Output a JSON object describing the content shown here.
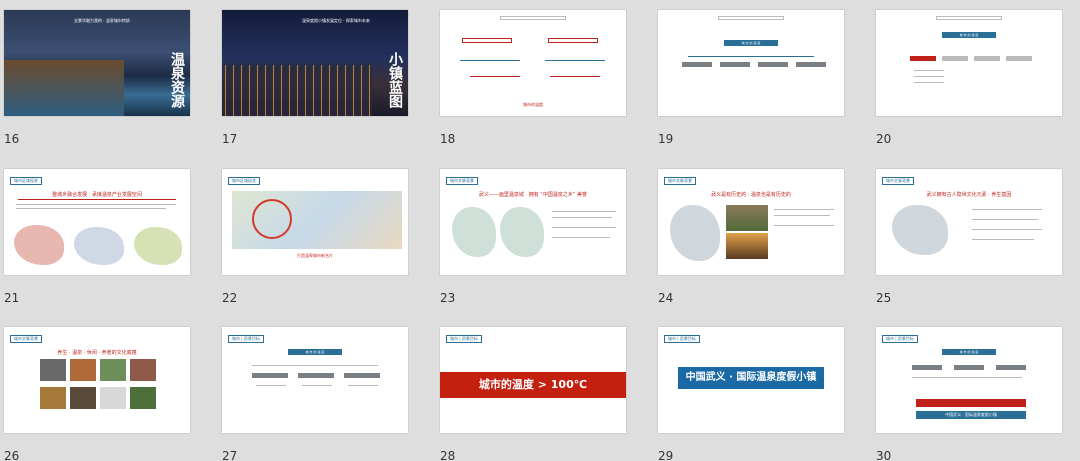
{
  "row1": [
    {
      "num": "16",
      "vtitle": "温泉资源",
      "caption": "全景华融为我的 · 温泉城市特质"
    },
    {
      "num": "17",
      "vtitle": "小镇蓝图",
      "caption": "温泉度假小镇发展定位 · 探索城市未来"
    },
    {
      "num": "18",
      "title": "城市的温度"
    },
    {
      "num": "19",
      "title": "城 市 的 温 度"
    },
    {
      "num": "20",
      "title": "城 市 的 温 度"
    }
  ],
  "row2": [
    {
      "num": "21",
      "header": "城市区域现状",
      "red": "整城乡融合发展 · 承接温泉产业发展空间"
    },
    {
      "num": "22",
      "header": "城市区域现状",
      "red": "打造温泉城市新名片"
    },
    {
      "num": "23",
      "header": "城市文脉背景",
      "red": "武义——画里温泉城 · 拥有 “中国温泉之乡” 美誉"
    },
    {
      "num": "24",
      "header": "城市文脉背景",
      "red": "武义是有历史的 · 温泉也是有历史的"
    },
    {
      "num": "25",
      "header": "城市文脉背景",
      "red": "武义拥有古人隐世文化元素 · 养生基因"
    }
  ],
  "row3": [
    {
      "num": "26",
      "header": "城市文脉背景",
      "red": "养生 · 温泉  · 休闲 · 养老的文化底蕴"
    },
    {
      "num": "27",
      "header": "城市 | 愿景目标",
      "title": "城 市 的 温 度"
    },
    {
      "num": "28",
      "header": "城市 | 愿景目标",
      "banner": "城市的温度 > 100℃"
    },
    {
      "num": "29",
      "header": "城市 | 愿景目标",
      "banner": "中国武义 · 国际温泉度假小镇"
    },
    {
      "num": "30",
      "header": "城市 | 愿景目标",
      "title": "城 市 的 温 度",
      "banner": "中国武义 · 国际温泉度假小镇"
    }
  ],
  "colors": {
    "accent": "#2a6f97",
    "red": "#c0221b",
    "bg": "#dedede"
  }
}
